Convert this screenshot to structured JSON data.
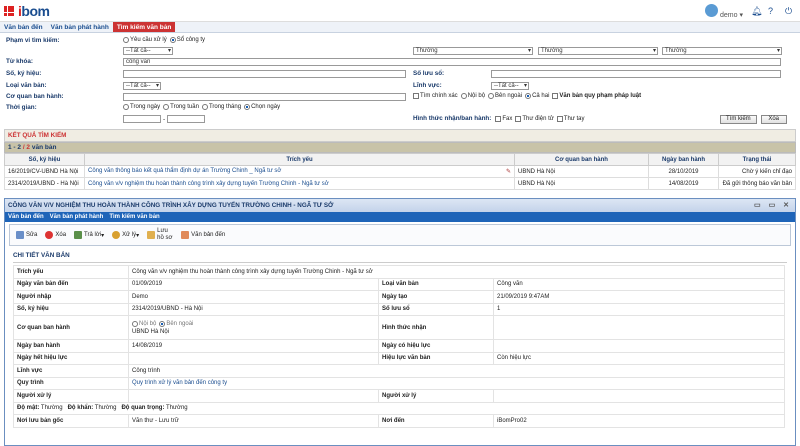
{
  "app": {
    "logo_a": "i",
    "logo_b": "bom",
    "user": "demo"
  },
  "nav": [
    "Văn bản đến",
    "Văn bản phát hành",
    "Tìm kiếm văn bản"
  ],
  "search": {
    "scope_label": "Phạm vi tìm kiếm:",
    "scope_opt1": "Yêu cầu xử lý",
    "scope_opt2": "Sổ công ty",
    "all": "--Tất cả--",
    "normal": "Thường",
    "keyword_label": "Từ khóa:",
    "keyword_value": "công văn",
    "sokyhieu_label": "Số, ký hiệu:",
    "soluuso_label": "Số lưu sổ:",
    "loaivb_label": "Loại văn bản:",
    "linhvuc_label": "Lĩnh vực:",
    "coquan_label": "Cơ quan ban hành:",
    "exact": "Tìm chính xác",
    "internal": "Nội bộ",
    "external": "Bên ngoài",
    "both": "Cả hai",
    "qppl": "Văn bản quy phạm pháp luật",
    "time_label": "Thời gian:",
    "t_day": "Trong ngày",
    "t_week": "Trong tuần",
    "t_month": "Trong tháng",
    "t_choose": "Chọn ngày",
    "form_label": "Hình thức nhận/ban hành:",
    "fax": "Fax",
    "email": "Thư điện tử",
    "hand": "Thư tay",
    "btn_search": "Tìm kiếm",
    "btn_clear": "Xóa"
  },
  "results": {
    "title": "KẾT QUẢ TÌM KIẾM",
    "count_a": "1 - 2",
    "count_b": " / 2 ",
    "count_c": "văn bản",
    "headers": [
      "Số, ký hiệu",
      "Trích yếu",
      "Cơ quan ban hành",
      "Ngày ban hành",
      "Trạng thái"
    ],
    "rows": [
      {
        "so": "16/2019/CV-UBND Hà Nội",
        "trich": "Công văn thông báo kết quả thẩm định dự án Trường Chinh _ Ngã tư sở",
        "cq": "UBND Hà Nội",
        "ngay": "28/10/2019",
        "tt": "Chờ ý kiến chỉ đạo"
      },
      {
        "so": "2314/2019/UBND - Hà Nội",
        "trich": "Công văn v/v nghiệm thu hoàn thành công trình xây dựng tuyến Trường Chinh - Ngã tư sở",
        "cq": "UBND Hà Nội",
        "ngay": "14/08/2019",
        "tt": "Đã gửi thông báo văn bản"
      }
    ]
  },
  "modal": {
    "title": "CÔNG VĂN V/V NGHIỆM THU HOÀN THÀNH CÔNG TRÌNH XÂY DỰNG TUYẾN TRƯỜNG CHINH - NGÃ TƯ SỞ",
    "nav": [
      "Văn bản đến",
      "Văn bản phát hành",
      "Tìm kiếm văn bản"
    ],
    "tools": [
      "Sửa",
      "Xóa",
      "Trả lời",
      "Xử lý",
      "Lưu hồ sơ",
      "Văn bản đến"
    ],
    "section": "CHI TIẾT VĂN BẢN",
    "trichyeu_k": "Trích yếu",
    "trichyeu_v": "Công văn v/v nghiệm thu hoàn thành công trình xây dựng tuyến Trường Chinh - Ngã tư sở",
    "rows": [
      [
        "Ngày văn bản đến",
        "01/09/2019",
        "Loại văn bản",
        "Công văn"
      ],
      [
        "Người nhập",
        "Demo",
        "Ngày tạo",
        "21/09/2019 9:47AM"
      ],
      [
        "Số, ký hiệu",
        "2314/2019/UBND - Hà Nội",
        "Số lưu sổ",
        "1"
      ],
      [
        "Cơ quan ban hành",
        "",
        "Hình thức nhận",
        ""
      ],
      [
        "Ngày ban hành",
        "14/08/2019",
        "Ngày có hiệu lực",
        ""
      ],
      [
        "Ngày hết hiệu lực",
        "",
        "Hiệu lực văn bản",
        "Còn hiệu lực"
      ],
      [
        "Lĩnh vực",
        "Công trình",
        "",
        ""
      ],
      [
        "Quy trình",
        "Quy trình xử lý văn bản đến công ty",
        "",
        ""
      ],
      [
        "Người xử lý",
        "",
        "Người xử lý",
        ""
      ]
    ],
    "cq_internal": "Nội bộ",
    "cq_external": "Bên ngoài",
    "cq_value": "UBND Hà Nội",
    "mat_k": "Độ mật:",
    "mat_v": "Thường",
    "khan_k": "Độ khẩn:",
    "khan_v": "Thường",
    "qt_k": "Độ quan trọng:",
    "qt_v": "Thường",
    "luu_k": "Nơi lưu bản gốc",
    "luu_v": "Văn thư - Lưu trữ",
    "noiden_k": "Nơi đến",
    "noiden_v": "iBomPro02"
  }
}
